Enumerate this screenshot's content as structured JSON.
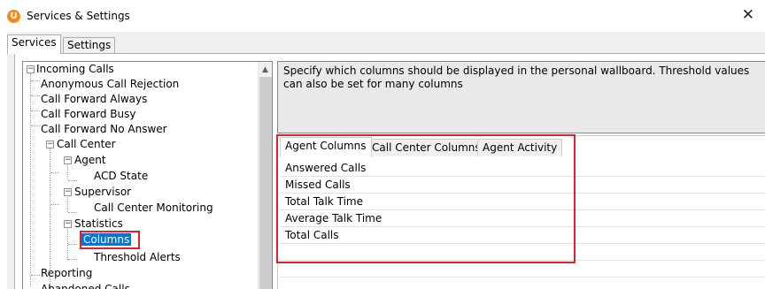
{
  "window": {
    "title": "Services & Settings",
    "app_icon_letter": "U",
    "close_glyph": "✕"
  },
  "outer_tabs": [
    {
      "label": "Services",
      "active": true
    },
    {
      "label": "Settings",
      "active": false
    }
  ],
  "tree": {
    "items": [
      {
        "label": "Incoming Calls",
        "expander": "−"
      },
      {
        "label": "Anonymous Call Rejection"
      },
      {
        "label": "Call Forward Always"
      },
      {
        "label": "Call Forward Busy"
      },
      {
        "label": "Call Forward No Answer"
      },
      {
        "label": "Call Center",
        "expander": "−"
      },
      {
        "label": "Agent",
        "expander": "−"
      },
      {
        "label": "ACD State"
      },
      {
        "label": "Supervisor",
        "expander": "−"
      },
      {
        "label": "Call Center Monitoring"
      },
      {
        "label": "Statistics",
        "expander": "−"
      },
      {
        "label": "Columns",
        "selected": true
      },
      {
        "label": "Threshold Alerts"
      },
      {
        "label": "Reporting"
      },
      {
        "label": "Abandoned Calls"
      }
    ],
    "scroll_up_glyph": "▲"
  },
  "description": "Specify which columns should be displayed in the personal wallboard.  Threshold values can also be set for many columns",
  "inner_tabs": [
    {
      "label": "Agent Columns",
      "active": true
    },
    {
      "label": "Call Center Columns",
      "active": false
    },
    {
      "label": "Agent Activity",
      "active": false
    }
  ],
  "columns": [
    "Answered Calls",
    "Missed Calls",
    "Total Talk Time",
    "Average Talk Time",
    "Total Calls"
  ],
  "colors": {
    "selection": "#0078d7",
    "highlight_box": "#e0212a",
    "app_icon": "#f28a1e"
  }
}
